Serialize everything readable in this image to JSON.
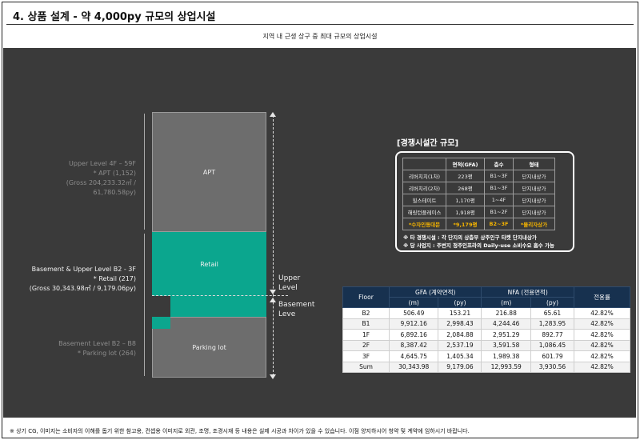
{
  "header": {
    "title": "4.  상품 설계 - 약 4,000py 규모의 상업시설",
    "subtitle": "지역 내 근생 상구 중 최대 규모의 상업시설"
  },
  "diagram": {
    "upper_label": {
      "line1": "Upper Level 4F – 59F",
      "line2": "* APT (1,152)",
      "line3": "(Gross 204,233.32㎡ / 61,780.58py)"
    },
    "middle_label": {
      "line1": "Basement & Upper Level B2 - 3F",
      "line2": "* Retail (217)",
      "line3": "(Gross 30,343.98㎡ / 9,179.06py)"
    },
    "lower_label": {
      "line1": "Basement Level B2 – B8",
      "line2": "* Parking lot (264)"
    },
    "blocks": {
      "apt": "APT",
      "retail": "Retail",
      "parking": "Parking lot"
    },
    "side": {
      "upper": "Upper Level",
      "basement": "Basement Leve"
    }
  },
  "competition": {
    "title": "[경쟁시설간 규모]",
    "headers": [
      "",
      "면적(GFA)",
      "층수",
      "형태"
    ],
    "rows": [
      [
        "리버치치(1차)",
        "223평",
        "B1~3F",
        "단지내상가"
      ],
      [
        "리버치리(2차)",
        "268평",
        "B1~3F",
        "단지내상가"
      ],
      [
        "힐스테이트",
        "1,170평",
        "1~4F",
        "단지내상가"
      ],
      [
        "해링턴플레이스",
        "1,918평",
        "B1~2F",
        "단지내상가"
      ]
    ],
    "highlight_row": [
      "*수자인동대문",
      "*9,179평",
      "B2~3F",
      "*몰리자상가"
    ],
    "note1": "※ 타 경쟁시설 : 각 단지의 상층부 상주인구 타켓 단지내상가",
    "note2": "※ 당 사업지 : 주변지 정주인프라의 Daily-use 소비수요 흡수 가능"
  },
  "floor_table": {
    "header_floor": "Floor",
    "header_gfa": "GFA (계약면적)",
    "header_nfa": "NFA (전용면적)",
    "header_ratio": "전용률",
    "unit_m": "(m)",
    "unit_py": "(py)",
    "rows": [
      [
        "B2",
        "506.49",
        "153.21",
        "216.88",
        "65.61",
        "42.82%"
      ],
      [
        "B1",
        "9,912.16",
        "2,998.43",
        "4,244.46",
        "1,283.95",
        "42.82%"
      ],
      [
        "1F",
        "6,892.16",
        "2,084.88",
        "2,951.29",
        "892.77",
        "42.82%"
      ],
      [
        "2F",
        "8,387.42",
        "2,537.19",
        "3,591.58",
        "1,086.45",
        "42.82%"
      ],
      [
        "3F",
        "4,645.75",
        "1,405.34",
        "1,989.38",
        "601.79",
        "42.82%"
      ],
      [
        "Sum",
        "30,343.98",
        "9,179.06",
        "12,993.59",
        "3,930.56",
        "42.82%"
      ]
    ]
  },
  "footer": {
    "note": "※ 상기 CG, 이미지는 소비자의 이해를 돕기 위한 참고용, 컨셉용 이미지로 외관, 조명, 조경시재 등 내용은 실제 시공과 차이가 있을 수 있습니다. 이점 양지하시어 청약 및 계약에 임하시기 바랍니다."
  },
  "colors": {
    "retail": "#0ba68e",
    "background": "#3a3a3a",
    "table_header": "#17314f",
    "highlight": "#f5b400"
  }
}
